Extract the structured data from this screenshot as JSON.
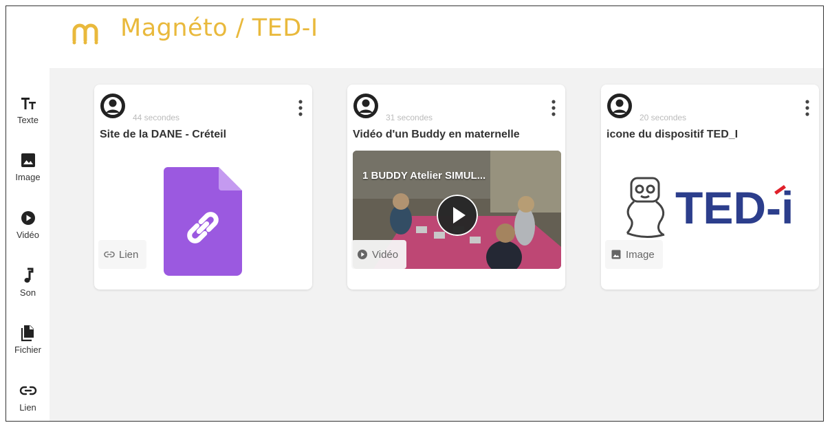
{
  "app": {
    "title": "Magnéto / TED-I",
    "brand_color": "#e9b93c"
  },
  "sidebar": {
    "items": [
      {
        "label": "Texte",
        "icon": "text-format-icon"
      },
      {
        "label": "Image",
        "icon": "image-icon"
      },
      {
        "label": "Vidéo",
        "icon": "play-circle-icon"
      },
      {
        "label": "Son",
        "icon": "music-note-icon"
      },
      {
        "label": "Fichier",
        "icon": "file-icon"
      },
      {
        "label": "Lien",
        "icon": "link-icon"
      }
    ]
  },
  "cards": [
    {
      "time": "44 secondes",
      "title": "Site de la DANE - Créteil",
      "type_label": "Lien",
      "type_icon": "link-icon",
      "media": "link-file-icon",
      "media_color": "#9b59e0"
    },
    {
      "time": "31 secondes",
      "title": "Vidéo d'un Buddy en maternelle",
      "type_label": "Vidéo",
      "type_icon": "play-circle-icon",
      "media": "video-thumbnail",
      "video_title": "1 BUDDY Atelier SIMUL..."
    },
    {
      "time": "20 secondes",
      "title": "icone du dispositif TED_I",
      "type_label": "Image",
      "type_icon": "image-icon",
      "media": "ted-i-logo",
      "logo_text": "TED-i",
      "logo_color": "#2c3e8c",
      "logo_accent": "#e0202a"
    }
  ]
}
